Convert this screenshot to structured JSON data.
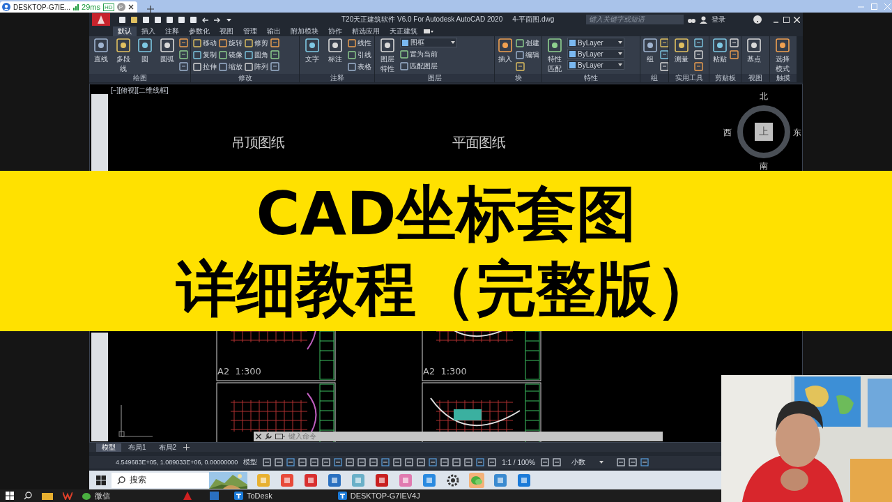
{
  "browser": {
    "tab_title": "DESKTOP-G7IE...",
    "latency": "29ms",
    "quality_badge": "HD",
    "profile_initial": "P"
  },
  "autocad": {
    "app_title": "T20天正建筑软件 V6.0 For Autodesk AutoCAD 2020",
    "file_name": "4-平面图.dwg",
    "search": {
      "placeholder": "键入关键字或短语"
    },
    "login": "登录",
    "ribbon_tabs": [
      {
        "label": "默认",
        "selected": true
      },
      {
        "label": "插入",
        "selected": false
      },
      {
        "label": "注释",
        "selected": false
      },
      {
        "label": "参数化",
        "selected": false
      },
      {
        "label": "视图",
        "selected": false
      },
      {
        "label": "管理",
        "selected": false
      },
      {
        "label": "输出",
        "selected": false
      },
      {
        "label": "附加模块",
        "selected": false
      },
      {
        "label": "协作",
        "selected": false
      },
      {
        "label": "精选应用",
        "selected": false
      },
      {
        "label": "天正建筑",
        "selected": false
      }
    ],
    "panels": [
      {
        "label": "绘图",
        "items": [
          {
            "kind": "large",
            "label": "直线"
          },
          {
            "kind": "large",
            "label": "多段线"
          },
          {
            "kind": "large",
            "label": "圆"
          },
          {
            "kind": "large",
            "label": "圆弧"
          },
          {
            "kind": "icon"
          },
          {
            "kind": "icon"
          },
          {
            "kind": "icon"
          }
        ]
      },
      {
        "label": "修改",
        "items": [
          {
            "kind": "small",
            "label": "移动"
          },
          {
            "kind": "small",
            "label": "复制"
          },
          {
            "kind": "small",
            "label": "拉伸"
          },
          {
            "kind": "small",
            "label": "旋转"
          },
          {
            "kind": "small",
            "label": "镜像"
          },
          {
            "kind": "small",
            "label": "缩放"
          },
          {
            "kind": "small",
            "label": "修剪"
          },
          {
            "kind": "small",
            "label": "圆角"
          },
          {
            "kind": "small",
            "label": "阵列"
          },
          {
            "kind": "icon"
          },
          {
            "kind": "icon"
          },
          {
            "kind": "icon"
          }
        ]
      },
      {
        "label": "注释",
        "items": [
          {
            "kind": "large",
            "label": "文字"
          },
          {
            "kind": "large",
            "label": "标注"
          },
          {
            "kind": "small",
            "label": "线性"
          },
          {
            "kind": "small",
            "label": "引线"
          },
          {
            "kind": "small",
            "label": "表格"
          }
        ]
      },
      {
        "label": "图层",
        "items": [
          {
            "kind": "large",
            "label": "图层特性"
          },
          {
            "kind": "dropdown",
            "value": "图框"
          },
          {
            "kind": "small",
            "label": "置为当前"
          },
          {
            "kind": "small",
            "label": "匹配图层"
          }
        ]
      },
      {
        "label": "块",
        "items": [
          {
            "kind": "large",
            "label": "插入"
          },
          {
            "kind": "small",
            "label": "创建"
          },
          {
            "kind": "small",
            "label": "编辑"
          },
          {
            "kind": "icon"
          }
        ]
      },
      {
        "label": "特性",
        "items": [
          {
            "kind": "large",
            "label": "特性匹配"
          },
          {
            "kind": "dropdown",
            "value": "ByLayer"
          },
          {
            "kind": "dropdown",
            "value": "ByLayer"
          },
          {
            "kind": "dropdown",
            "value": "ByLayer"
          }
        ]
      },
      {
        "label": "组",
        "items": [
          {
            "kind": "large",
            "label": "组"
          },
          {
            "kind": "icon"
          },
          {
            "kind": "icon"
          },
          {
            "kind": "icon"
          }
        ]
      },
      {
        "label": "实用工具",
        "items": [
          {
            "kind": "large",
            "label": "测量"
          },
          {
            "kind": "icon"
          },
          {
            "kind": "icon"
          },
          {
            "kind": "icon"
          }
        ]
      },
      {
        "label": "剪贴板",
        "items": [
          {
            "kind": "large",
            "label": "粘贴"
          },
          {
            "kind": "icon"
          },
          {
            "kind": "icon"
          }
        ]
      },
      {
        "label": "视图",
        "items": [
          {
            "kind": "large",
            "label": "基点"
          }
        ]
      },
      {
        "label": "触摸",
        "items": [
          {
            "kind": "large",
            "label": "选择模式"
          }
        ]
      }
    ],
    "viewport": {
      "label": "[−][俯视][二维线框]",
      "drawing_titles": [
        "吊顶图纸",
        "平面图纸"
      ],
      "sheet_scales": [
        "A2  1:300",
        "A2  1:300"
      ],
      "viewcube": {
        "north": "北",
        "west": "西",
        "top": "上",
        "east": "东",
        "south": "南"
      }
    },
    "command_line": {
      "placeholder": "键入命令"
    },
    "layout_tabs": [
      {
        "label": "模型",
        "selected": true
      },
      {
        "label": "布局1",
        "selected": false
      },
      {
        "label": "布局2",
        "selected": false
      }
    ],
    "status_bar": {
      "coordinates": "4.549683E+05, 1.089033E+06, 0.00000000",
      "space": "模型",
      "scale": "1:1 / 100%",
      "units": "小数"
    }
  },
  "remote_taskbar": {
    "search_placeholder": "搜索"
  },
  "banner": {
    "lines": [
      "CAD坐标套图",
      "详细教程（完整版）"
    ]
  },
  "local_taskbar": {
    "apps": [
      {
        "kind": "labeled",
        "label": "微信"
      },
      {
        "kind": "pinned"
      },
      {
        "kind": "pinned"
      },
      {
        "kind": "labeled",
        "label": "ToDesk"
      },
      {
        "kind": "labeled",
        "label": "DESKTOP-G7IEV4J"
      }
    ]
  }
}
